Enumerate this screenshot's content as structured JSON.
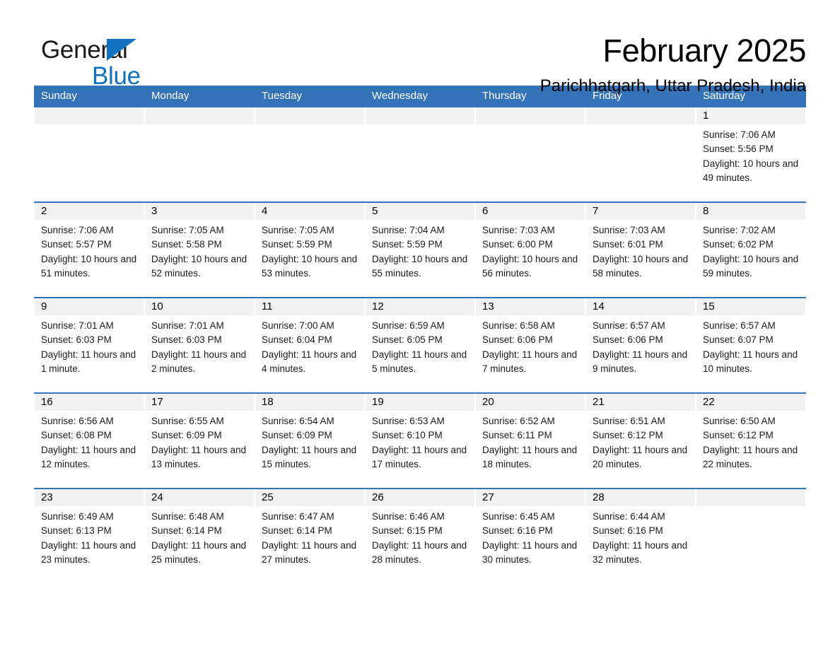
{
  "brand": {
    "name_part1": "General",
    "name_part2": "Blue",
    "triangle_color": "#1271c0",
    "blue_color": "#1271c0"
  },
  "header": {
    "title": "February 2025",
    "subtitle": "Parichhatgarh, Uttar Pradesh, India"
  },
  "theme": {
    "header_blue": "#3573b9",
    "day_band_gray": "#f2f2f2",
    "row_divider": "#3573b9"
  },
  "calendar": {
    "weekday_headers": [
      "Sunday",
      "Monday",
      "Tuesday",
      "Wednesday",
      "Thursday",
      "Friday",
      "Saturday"
    ],
    "weeks": [
      [
        {
          "day": "",
          "sunrise": "",
          "sunset": "",
          "daylight": ""
        },
        {
          "day": "",
          "sunrise": "",
          "sunset": "",
          "daylight": ""
        },
        {
          "day": "",
          "sunrise": "",
          "sunset": "",
          "daylight": ""
        },
        {
          "day": "",
          "sunrise": "",
          "sunset": "",
          "daylight": ""
        },
        {
          "day": "",
          "sunrise": "",
          "sunset": "",
          "daylight": ""
        },
        {
          "day": "",
          "sunrise": "",
          "sunset": "",
          "daylight": ""
        },
        {
          "day": "1",
          "sunrise": "Sunrise: 7:06 AM",
          "sunset": "Sunset: 5:56 PM",
          "daylight": "Daylight: 10 hours and 49 minutes."
        }
      ],
      [
        {
          "day": "2",
          "sunrise": "Sunrise: 7:06 AM",
          "sunset": "Sunset: 5:57 PM",
          "daylight": "Daylight: 10 hours and 51 minutes."
        },
        {
          "day": "3",
          "sunrise": "Sunrise: 7:05 AM",
          "sunset": "Sunset: 5:58 PM",
          "daylight": "Daylight: 10 hours and 52 minutes."
        },
        {
          "day": "4",
          "sunrise": "Sunrise: 7:05 AM",
          "sunset": "Sunset: 5:59 PM",
          "daylight": "Daylight: 10 hours and 53 minutes."
        },
        {
          "day": "5",
          "sunrise": "Sunrise: 7:04 AM",
          "sunset": "Sunset: 5:59 PM",
          "daylight": "Daylight: 10 hours and 55 minutes."
        },
        {
          "day": "6",
          "sunrise": "Sunrise: 7:03 AM",
          "sunset": "Sunset: 6:00 PM",
          "daylight": "Daylight: 10 hours and 56 minutes."
        },
        {
          "day": "7",
          "sunrise": "Sunrise: 7:03 AM",
          "sunset": "Sunset: 6:01 PM",
          "daylight": "Daylight: 10 hours and 58 minutes."
        },
        {
          "day": "8",
          "sunrise": "Sunrise: 7:02 AM",
          "sunset": "Sunset: 6:02 PM",
          "daylight": "Daylight: 10 hours and 59 minutes."
        }
      ],
      [
        {
          "day": "9",
          "sunrise": "Sunrise: 7:01 AM",
          "sunset": "Sunset: 6:03 PM",
          "daylight": "Daylight: 11 hours and 1 minute."
        },
        {
          "day": "10",
          "sunrise": "Sunrise: 7:01 AM",
          "sunset": "Sunset: 6:03 PM",
          "daylight": "Daylight: 11 hours and 2 minutes."
        },
        {
          "day": "11",
          "sunrise": "Sunrise: 7:00 AM",
          "sunset": "Sunset: 6:04 PM",
          "daylight": "Daylight: 11 hours and 4 minutes."
        },
        {
          "day": "12",
          "sunrise": "Sunrise: 6:59 AM",
          "sunset": "Sunset: 6:05 PM",
          "daylight": "Daylight: 11 hours and 5 minutes."
        },
        {
          "day": "13",
          "sunrise": "Sunrise: 6:58 AM",
          "sunset": "Sunset: 6:06 PM",
          "daylight": "Daylight: 11 hours and 7 minutes."
        },
        {
          "day": "14",
          "sunrise": "Sunrise: 6:57 AM",
          "sunset": "Sunset: 6:06 PM",
          "daylight": "Daylight: 11 hours and 9 minutes."
        },
        {
          "day": "15",
          "sunrise": "Sunrise: 6:57 AM",
          "sunset": "Sunset: 6:07 PM",
          "daylight": "Daylight: 11 hours and 10 minutes."
        }
      ],
      [
        {
          "day": "16",
          "sunrise": "Sunrise: 6:56 AM",
          "sunset": "Sunset: 6:08 PM",
          "daylight": "Daylight: 11 hours and 12 minutes."
        },
        {
          "day": "17",
          "sunrise": "Sunrise: 6:55 AM",
          "sunset": "Sunset: 6:09 PM",
          "daylight": "Daylight: 11 hours and 13 minutes."
        },
        {
          "day": "18",
          "sunrise": "Sunrise: 6:54 AM",
          "sunset": "Sunset: 6:09 PM",
          "daylight": "Daylight: 11 hours and 15 minutes."
        },
        {
          "day": "19",
          "sunrise": "Sunrise: 6:53 AM",
          "sunset": "Sunset: 6:10 PM",
          "daylight": "Daylight: 11 hours and 17 minutes."
        },
        {
          "day": "20",
          "sunrise": "Sunrise: 6:52 AM",
          "sunset": "Sunset: 6:11 PM",
          "daylight": "Daylight: 11 hours and 18 minutes."
        },
        {
          "day": "21",
          "sunrise": "Sunrise: 6:51 AM",
          "sunset": "Sunset: 6:12 PM",
          "daylight": "Daylight: 11 hours and 20 minutes."
        },
        {
          "day": "22",
          "sunrise": "Sunrise: 6:50 AM",
          "sunset": "Sunset: 6:12 PM",
          "daylight": "Daylight: 11 hours and 22 minutes."
        }
      ],
      [
        {
          "day": "23",
          "sunrise": "Sunrise: 6:49 AM",
          "sunset": "Sunset: 6:13 PM",
          "daylight": "Daylight: 11 hours and 23 minutes."
        },
        {
          "day": "24",
          "sunrise": "Sunrise: 6:48 AM",
          "sunset": "Sunset: 6:14 PM",
          "daylight": "Daylight: 11 hours and 25 minutes."
        },
        {
          "day": "25",
          "sunrise": "Sunrise: 6:47 AM",
          "sunset": "Sunset: 6:14 PM",
          "daylight": "Daylight: 11 hours and 27 minutes."
        },
        {
          "day": "26",
          "sunrise": "Sunrise: 6:46 AM",
          "sunset": "Sunset: 6:15 PM",
          "daylight": "Daylight: 11 hours and 28 minutes."
        },
        {
          "day": "27",
          "sunrise": "Sunrise: 6:45 AM",
          "sunset": "Sunset: 6:16 PM",
          "daylight": "Daylight: 11 hours and 30 minutes."
        },
        {
          "day": "28",
          "sunrise": "Sunrise: 6:44 AM",
          "sunset": "Sunset: 6:16 PM",
          "daylight": "Daylight: 11 hours and 32 minutes."
        },
        {
          "day": "",
          "sunrise": "",
          "sunset": "",
          "daylight": ""
        }
      ]
    ]
  }
}
